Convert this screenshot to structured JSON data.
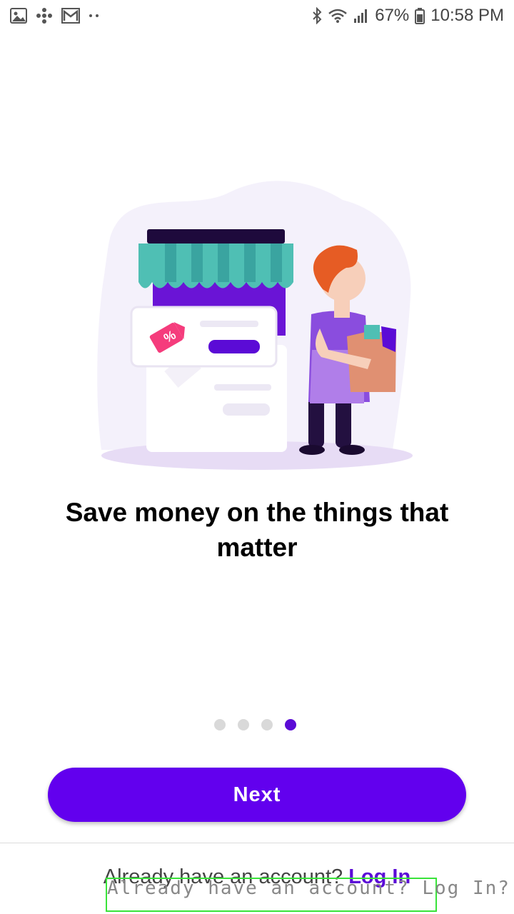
{
  "status_bar": {
    "battery": "67%",
    "time": "10:58 PM",
    "left_icons": [
      "gallery-icon",
      "fan-icon",
      "gmail-icon",
      "more-dots-icon"
    ],
    "right_icons": [
      "bluetooth-icon",
      "wifi-icon",
      "signal-icon",
      "battery-icon"
    ]
  },
  "onboarding": {
    "headline": "Save money on the things that matter",
    "page_count": 4,
    "active_page": 4,
    "next_label": "Next"
  },
  "footer": {
    "prompt": "Already have an account? ",
    "login_label": "Log In",
    "overlay_text": "Already have an account? Log In?"
  },
  "colors": {
    "accent": "#6200ee",
    "dot_active": "#5b0bd6",
    "dot_inactive": "#d9d9d9",
    "awning_teal": "#4fbfb4",
    "tag_pink": "#f53c7c",
    "overlay_green": "#39e33a"
  }
}
